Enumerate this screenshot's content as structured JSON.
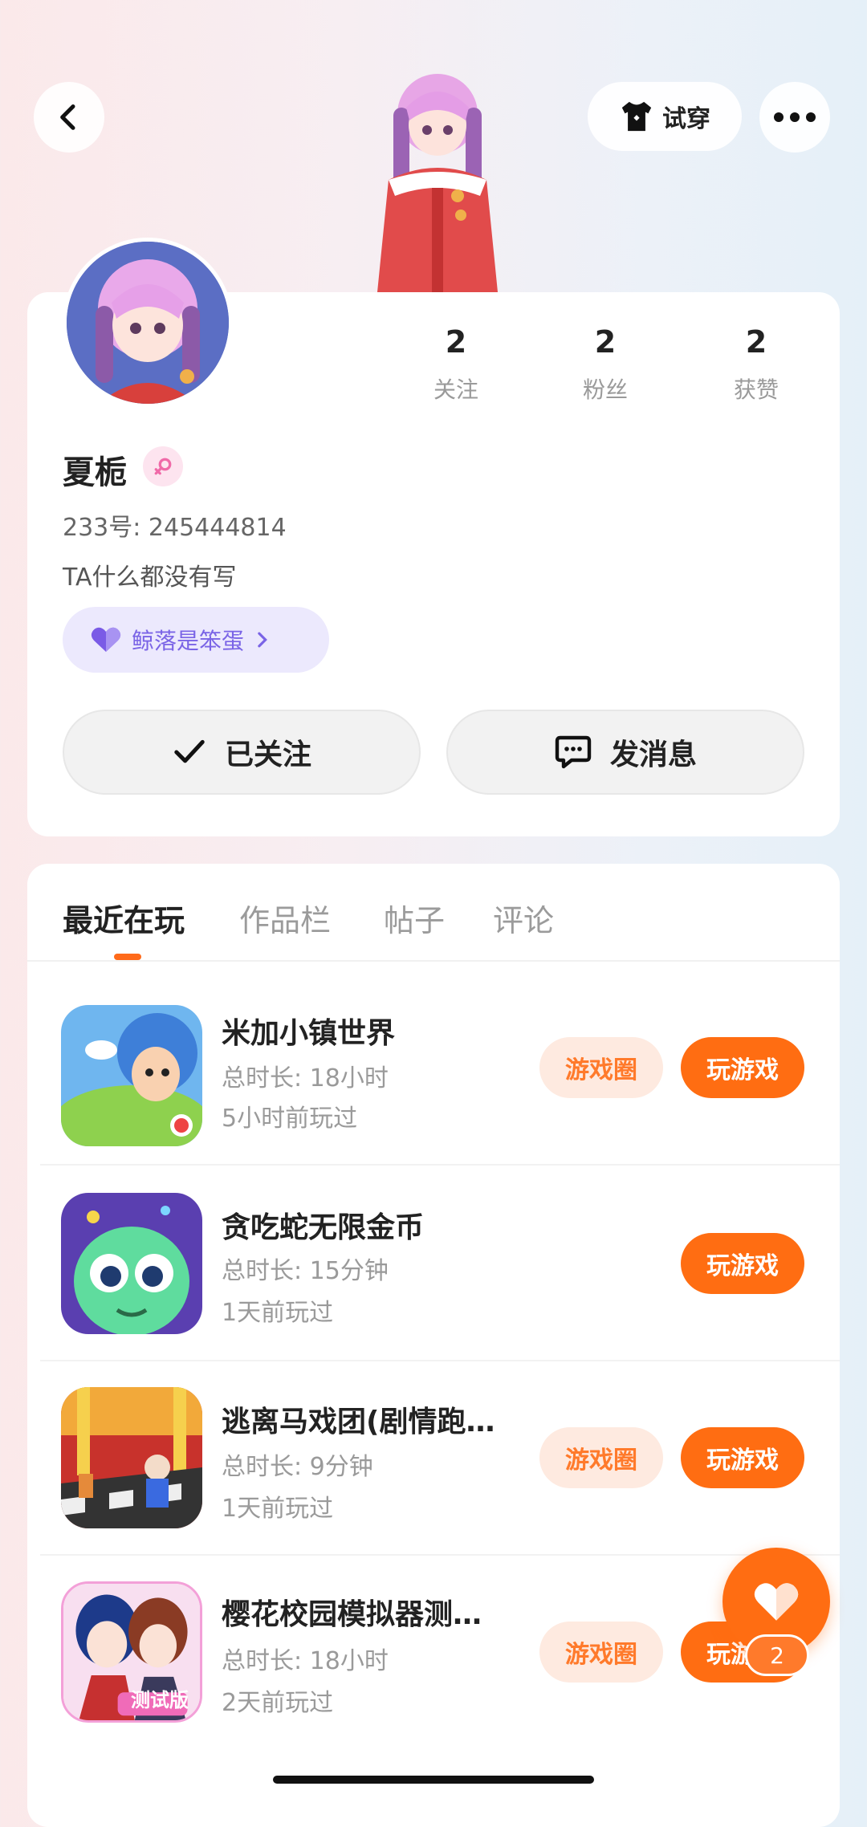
{
  "header": {
    "try_on_label": "试穿"
  },
  "profile": {
    "stats": [
      {
        "value": "2",
        "label": "关注"
      },
      {
        "value": "2",
        "label": "粉丝"
      },
      {
        "value": "2",
        "label": "获赞"
      }
    ],
    "name": "夏栀",
    "gender": "female",
    "uid": "233号: 245444814",
    "bio": "TA什么都没有写",
    "relation_chip": "鲸落是笨蛋",
    "follow_button": "已关注",
    "message_button": "发消息"
  },
  "tabs": [
    {
      "label": "最近在玩",
      "active": true
    },
    {
      "label": "作品栏",
      "active": false
    },
    {
      "label": "帖子",
      "active": false
    },
    {
      "label": "评论",
      "active": false
    }
  ],
  "games": [
    {
      "title": "米加小镇世界",
      "duration": "总时长: 18小时",
      "last_played": "5小时前玩过",
      "circle": "游戏圈",
      "play": "玩游戏"
    },
    {
      "title": "贪吃蛇无限金币",
      "duration": "总时长: 15分钟",
      "last_played": "1天前玩过",
      "circle": "",
      "play": "玩游戏"
    },
    {
      "title": "逃离马戏团(剧情跑…",
      "duration": "总时长: 9分钟",
      "last_played": "1天前玩过",
      "circle": "游戏圈",
      "play": "玩游戏"
    },
    {
      "title": "樱花校园模拟器测…",
      "duration": "总时长: 18小时",
      "last_played": "2天前玩过",
      "circle": "游戏圈",
      "play": "玩游戏",
      "icon_badge": "测试版"
    }
  ],
  "floating": {
    "like_count": "2"
  },
  "colors": {
    "accent": "#ff6d12",
    "accent_light": "#feeae0",
    "chip": "#7a64e6"
  }
}
